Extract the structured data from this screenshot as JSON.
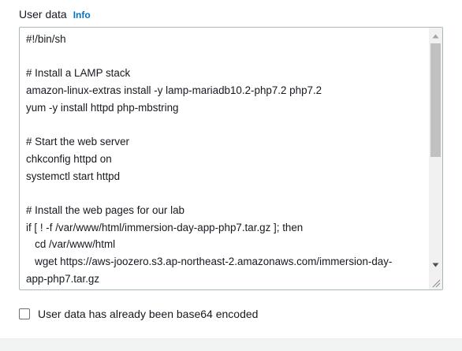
{
  "user_data": {
    "label": "User data",
    "info_link": "Info",
    "script_lines": [
      "#!/bin/sh",
      "",
      "# Install a LAMP stack",
      "amazon-linux-extras install -y lamp-mariadb10.2-php7.2 php7.2",
      "yum -y install httpd php-mbstring",
      "",
      "# Start the web server",
      "chkconfig httpd on",
      "systemctl start httpd",
      "",
      "# Install the web pages for our lab",
      "if [ ! -f /var/www/html/immersion-day-app-php7.tar.gz ]; then",
      "   cd /var/www/html",
      "   wget https://aws-joozero.s3.ap-northeast-2.amazonaws.com/immersion-day-",
      "app-php7.tar.gz"
    ]
  },
  "base64_checkbox": {
    "label": "User data has already been base64 encoded",
    "checked": false
  }
}
